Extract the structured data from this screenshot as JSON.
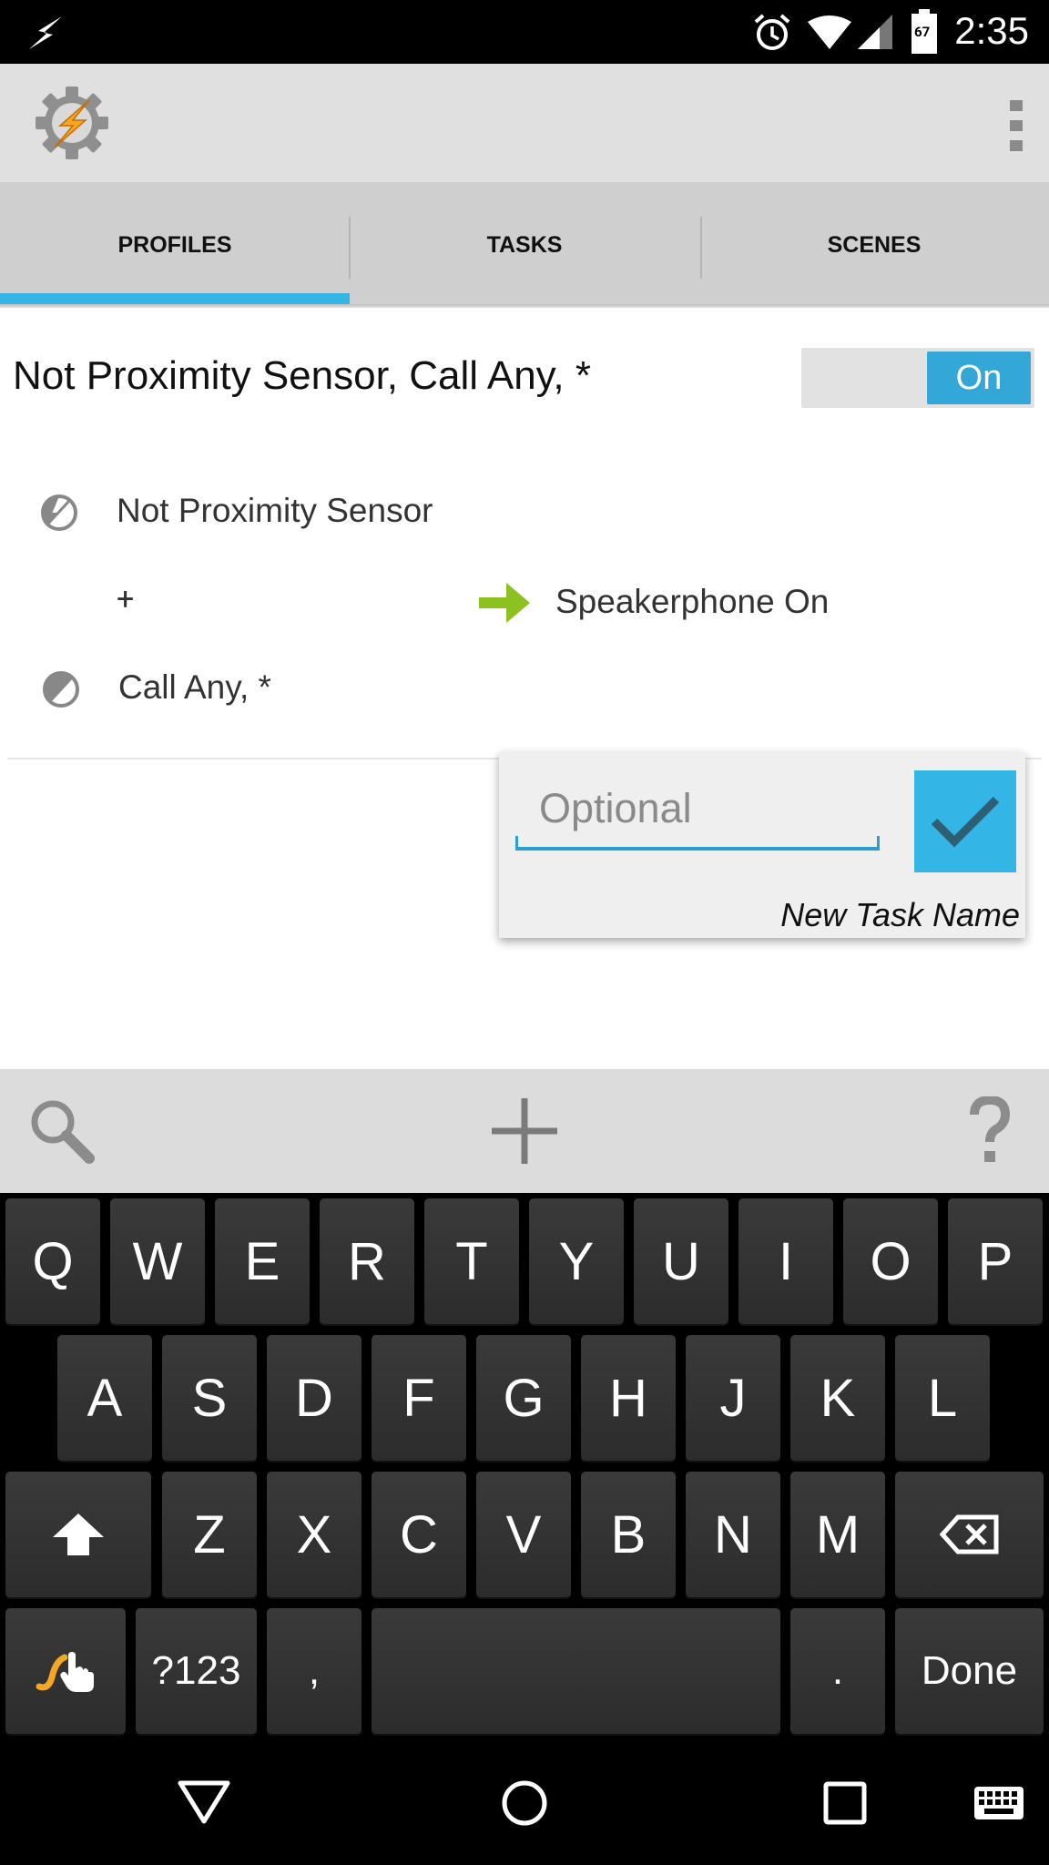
{
  "status_bar": {
    "time": "2:35",
    "battery_level": "67"
  },
  "tabs": [
    {
      "label": "PROFILES",
      "active": true
    },
    {
      "label": "TASKS",
      "active": false
    },
    {
      "label": "SCENES",
      "active": false
    }
  ],
  "profile": {
    "title": "Not Proximity Sensor, Call Any, *",
    "toggle_label": "On",
    "contexts": [
      "Not Proximity Sensor",
      "Call Any, *"
    ],
    "plus": "+",
    "task": "Speakerphone On"
  },
  "popup": {
    "input_value": "",
    "input_placeholder": "Optional",
    "caption": "New Task Name"
  },
  "keyboard": {
    "row1": [
      "Q",
      "W",
      "E",
      "R",
      "T",
      "Y",
      "U",
      "I",
      "O",
      "P"
    ],
    "row2": [
      "A",
      "S",
      "D",
      "F",
      "G",
      "H",
      "J",
      "K",
      "L"
    ],
    "row3": [
      "Z",
      "X",
      "C",
      "V",
      "B",
      "N",
      "M"
    ],
    "symbols_label": "?123",
    "comma": ",",
    "period": ".",
    "done_label": "Done"
  },
  "colors": {
    "accent": "#33b5e5",
    "task_arrow": "#8cc11f",
    "app_logo": "#f5a623"
  }
}
